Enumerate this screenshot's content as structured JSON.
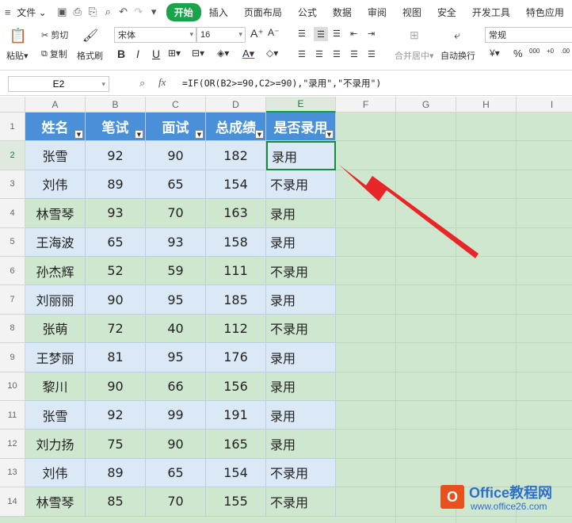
{
  "tabs": {
    "menu": "文件",
    "start": "开始",
    "insert": "插入",
    "layout": "页面布局",
    "formula": "公式",
    "data": "数据",
    "review": "审阅",
    "view": "视图",
    "security": "安全",
    "dev": "开发工具",
    "special": "特色应用"
  },
  "toolbar": {
    "paste": "粘贴",
    "cut": "剪切",
    "copy": "复制",
    "format_painter": "格式刷",
    "font": "宋体",
    "size": "16",
    "bold": "B",
    "italic": "I",
    "underline": "U",
    "merge": "合并居中",
    "wrap": "自动换行",
    "number_format": "常规",
    "currency": "¥",
    "percent": "%",
    "thousands": "000",
    "inc_dec": "+0",
    "dec_dec": ".00"
  },
  "formula_bar": {
    "name_box": "E2",
    "fx": "fx",
    "formula": "=IF(OR(B2>=90,C2>=90),\"录用\",\"不录用\")"
  },
  "columns": [
    "A",
    "B",
    "C",
    "D",
    "E",
    "F",
    "G",
    "H",
    "I"
  ],
  "table": {
    "headers": [
      "姓名",
      "笔试",
      "面试",
      "总成绩",
      "是否录用"
    ],
    "rows": [
      [
        "张雪",
        "92",
        "90",
        "182",
        "录用"
      ],
      [
        "刘伟",
        "89",
        "65",
        "154",
        "不录用"
      ],
      [
        "林雪琴",
        "93",
        "70",
        "163",
        "录用"
      ],
      [
        "王海波",
        "65",
        "93",
        "158",
        "录用"
      ],
      [
        "孙杰辉",
        "52",
        "59",
        "111",
        "不录用"
      ],
      [
        "刘丽丽",
        "90",
        "95",
        "185",
        "录用"
      ],
      [
        "张萌",
        "72",
        "40",
        "112",
        "不录用"
      ],
      [
        "王梦丽",
        "81",
        "95",
        "176",
        "录用"
      ],
      [
        "黎川",
        "90",
        "66",
        "156",
        "录用"
      ],
      [
        "张雪",
        "92",
        "99",
        "191",
        "录用"
      ],
      [
        "刘力扬",
        "75",
        "90",
        "165",
        "录用"
      ],
      [
        "刘伟",
        "89",
        "65",
        "154",
        "不录用"
      ],
      [
        "林雪琴",
        "85",
        "70",
        "155",
        "不录用"
      ]
    ]
  },
  "watermark": {
    "brand": "Office教程网",
    "url": "www.office26.com"
  },
  "colors": {
    "accent": "#1aa34a",
    "header_fill": "#4a90d9",
    "row_blue": "#dbe9f7",
    "row_green": "#cfe6cf",
    "arrow": "#e8262a"
  }
}
